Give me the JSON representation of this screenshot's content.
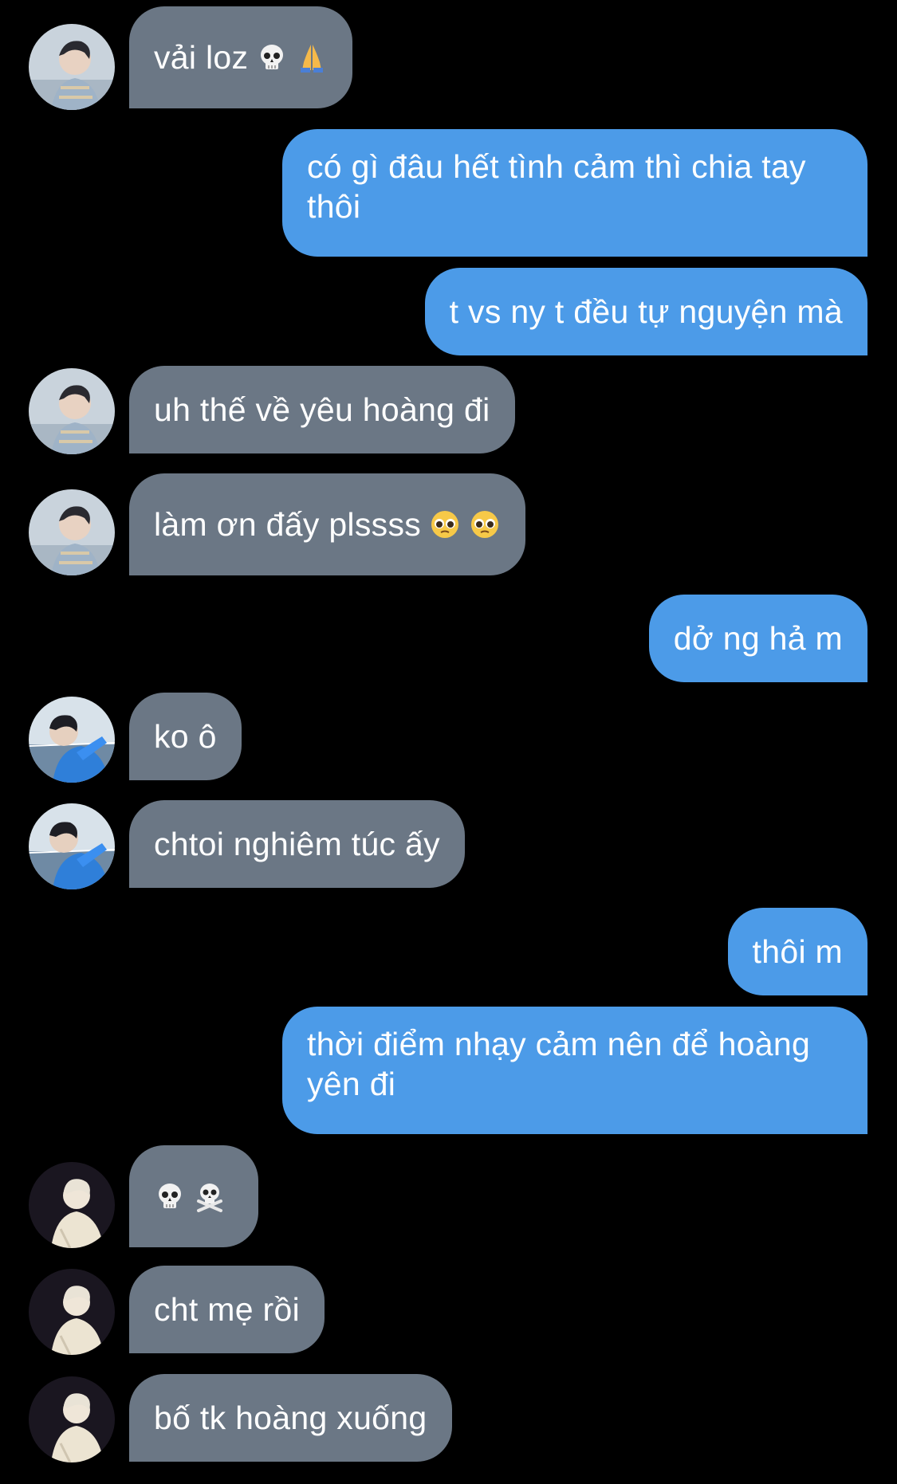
{
  "colors": {
    "background": "#000000",
    "incoming_bubble": "#6b7785",
    "outgoing_bubble": "#4c9be8",
    "text": "#ffffff"
  },
  "messages": [
    {
      "dir": "in",
      "avatar": "avatar-a",
      "text": "vải loz",
      "emojis": [
        "skull",
        "folded-hands"
      ]
    },
    {
      "dir": "out",
      "text": "có gì đâu hết tình cảm thì chia tay thôi"
    },
    {
      "dir": "out",
      "text": "t vs ny t đều tự nguyện mà"
    },
    {
      "dir": "in",
      "avatar": "avatar-a",
      "text": "uh thế về yêu hoàng đi"
    },
    {
      "dir": "in",
      "avatar": "avatar-a",
      "text": "làm ơn đấy plssss",
      "emojis": [
        "pleading-face",
        "pleading-face"
      ]
    },
    {
      "dir": "out",
      "text": "dở ng hả m"
    },
    {
      "dir": "in",
      "avatar": "avatar-b",
      "text": "ko ô"
    },
    {
      "dir": "in",
      "avatar": "avatar-b",
      "text": "chtoi nghiêm túc ấy"
    },
    {
      "dir": "out",
      "text": "thôi m"
    },
    {
      "dir": "out",
      "text": "thời điểm nhạy cảm nên để hoàng yên đi"
    },
    {
      "dir": "in",
      "avatar": "avatar-c",
      "text": "",
      "emojis": [
        "skull",
        "skull-crossbones"
      ]
    },
    {
      "dir": "in",
      "avatar": "avatar-c",
      "text": "cht mẹ rồi"
    },
    {
      "dir": "in",
      "avatar": "avatar-c",
      "text": "bố tk hoàng xuống"
    }
  ]
}
